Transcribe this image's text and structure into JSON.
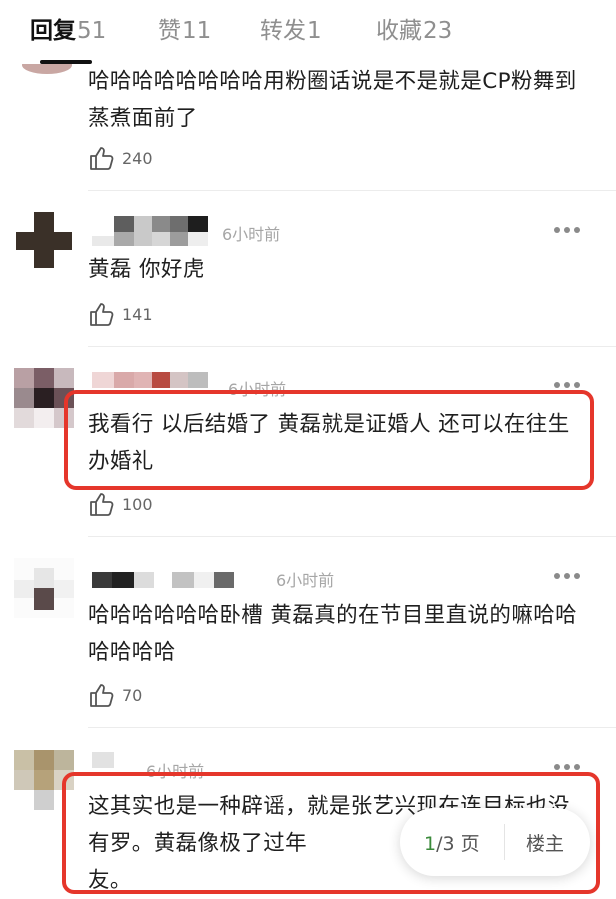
{
  "tabs": [
    {
      "label": "回复",
      "count": "51"
    },
    {
      "label": "赞",
      "count": "11"
    },
    {
      "label": "转发",
      "count": "1"
    },
    {
      "label": "收藏",
      "count": "23"
    }
  ],
  "comments": [
    {
      "time": "",
      "text": "哈哈哈哈哈哈哈哈用粉圈话说是不是就是CP粉舞到蒸煮面前了",
      "likes": "240"
    },
    {
      "time": "6小时前",
      "text": "黄磊 你好虎",
      "likes": "141"
    },
    {
      "time": "6小时前",
      "text": "我看行 以后结婚了 黄磊就是证婚人 还可以在往生办婚礼",
      "likes": "100"
    },
    {
      "time": "6小时前",
      "text": "哈哈哈哈哈哈卧槽 黄磊真的在节目里直说的嘛哈哈哈哈哈哈",
      "likes": "70"
    },
    {
      "time": "6小时前",
      "text": "这其实也是一种辟谣，就是张艺兴现在连目标也没有罗。黄磊像极了过年\n友。",
      "likes": ""
    }
  ],
  "pagination": {
    "current": "1",
    "rest": "/3 页"
  },
  "op_button": "楼主",
  "colors": {
    "highlight": "#e5362b",
    "active_tab": "#111111",
    "inactive_tab": "#8f8f8f",
    "page_current": "#3a8a3a"
  },
  "icons": {
    "like": "thumbs-up-icon",
    "more": "more-dots-icon"
  }
}
